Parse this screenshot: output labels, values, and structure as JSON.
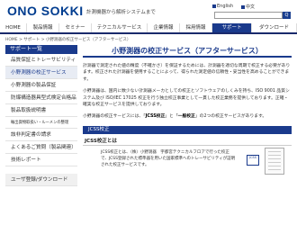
{
  "header": {
    "logo": "ONO SOKKI",
    "tagline": "計測機器から解析システムまで",
    "util": [
      {
        "label": "English",
        "color": "#1a3a8c"
      },
      {
        "label": "中文",
        "color": "#1a3a8c"
      },
      {
        "label": "お問い合わせ",
        "color": "#6a8fc9"
      },
      {
        "label": "メールマガジン",
        "color": "#6a8fc9"
      },
      {
        "label": "サイトマップ",
        "color": "#6a8fc9"
      }
    ],
    "search_button": "Q"
  },
  "nav": [
    {
      "label": "HOME",
      "active": false
    },
    {
      "label": "製品情報",
      "active": false
    },
    {
      "label": "セミナー",
      "active": false
    },
    {
      "label": "テクニカルサービス",
      "active": false
    },
    {
      "label": "企業情報",
      "active": false
    },
    {
      "label": "採用情報",
      "active": false
    },
    {
      "label": "サポート",
      "active": true
    },
    {
      "label": "ダウンロード",
      "active": false
    }
  ],
  "breadcrumb": "HOME > サポート > 小野測器の校正サービス（アフターサービス）",
  "sidebar": {
    "heading": "サポート一覧",
    "items": [
      {
        "label": "品質保証とトレーサビリティ",
        "active": false,
        "small": false
      },
      {
        "label": "小野測器の校正サービス",
        "active": true,
        "small": false
      },
      {
        "label": "小野測器の製品保証",
        "active": false,
        "small": false
      },
      {
        "label": "防爆構造器具型式検定合格品",
        "active": false,
        "small": false
      },
      {
        "label": "製品取扱説明書",
        "active": false,
        "small": false
      },
      {
        "label": "輸出貨物取扱い・ルーメンの整理",
        "active": false,
        "small": true
      },
      {
        "label": "該非判定書の請求",
        "active": false,
        "small": false
      },
      {
        "label": "よくあるご質問（製品関連）",
        "active": false,
        "small": false
      },
      {
        "label": "技術レポート",
        "active": false,
        "small": false
      },
      {
        "label": "ユーザ登録/ダウンロード",
        "active": false,
        "small": false,
        "last": true
      }
    ]
  },
  "main": {
    "title": "小野測器の校正サービス（アフターサービス）",
    "para1": "計測器で測定された値の精度（不確かさ）を保証するためには、計測器を適切な周期で校正する必要があります。校正された計測器を使用することによって、得られた測定値の信頼性・妥当性を高めることができます。",
    "para2": "小野測器は、国内に数少ない計測器メーカとしての校正とソフトウェアのしくみを持ち、ISO 9001 品質システム及び ISO/IEC 17025 校正を行う独立校正事業として一貫した校正業務を提供しております。正確・確実な校正サービスを提供しております。",
    "para3_prefix": "小野測器の校正サービスには、「",
    "para3_bold1": "JCSS校正",
    "para3_mid": "」と「",
    "para3_bold2": "一般校正",
    "para3_suffix": "」の2つの校正サービスがあります。",
    "section_bar": "JCSS校正",
    "sub_heading": "JCSS校正とは",
    "sub_text": "JCSS校正とは、（株）小野測器　宇都宮テクニカルフロアで行った校正で、JCSS登録された標準器を用いた国家標準へのトレーサビリティが証明された校正サービスです。",
    "cert_label": "JCSS"
  }
}
